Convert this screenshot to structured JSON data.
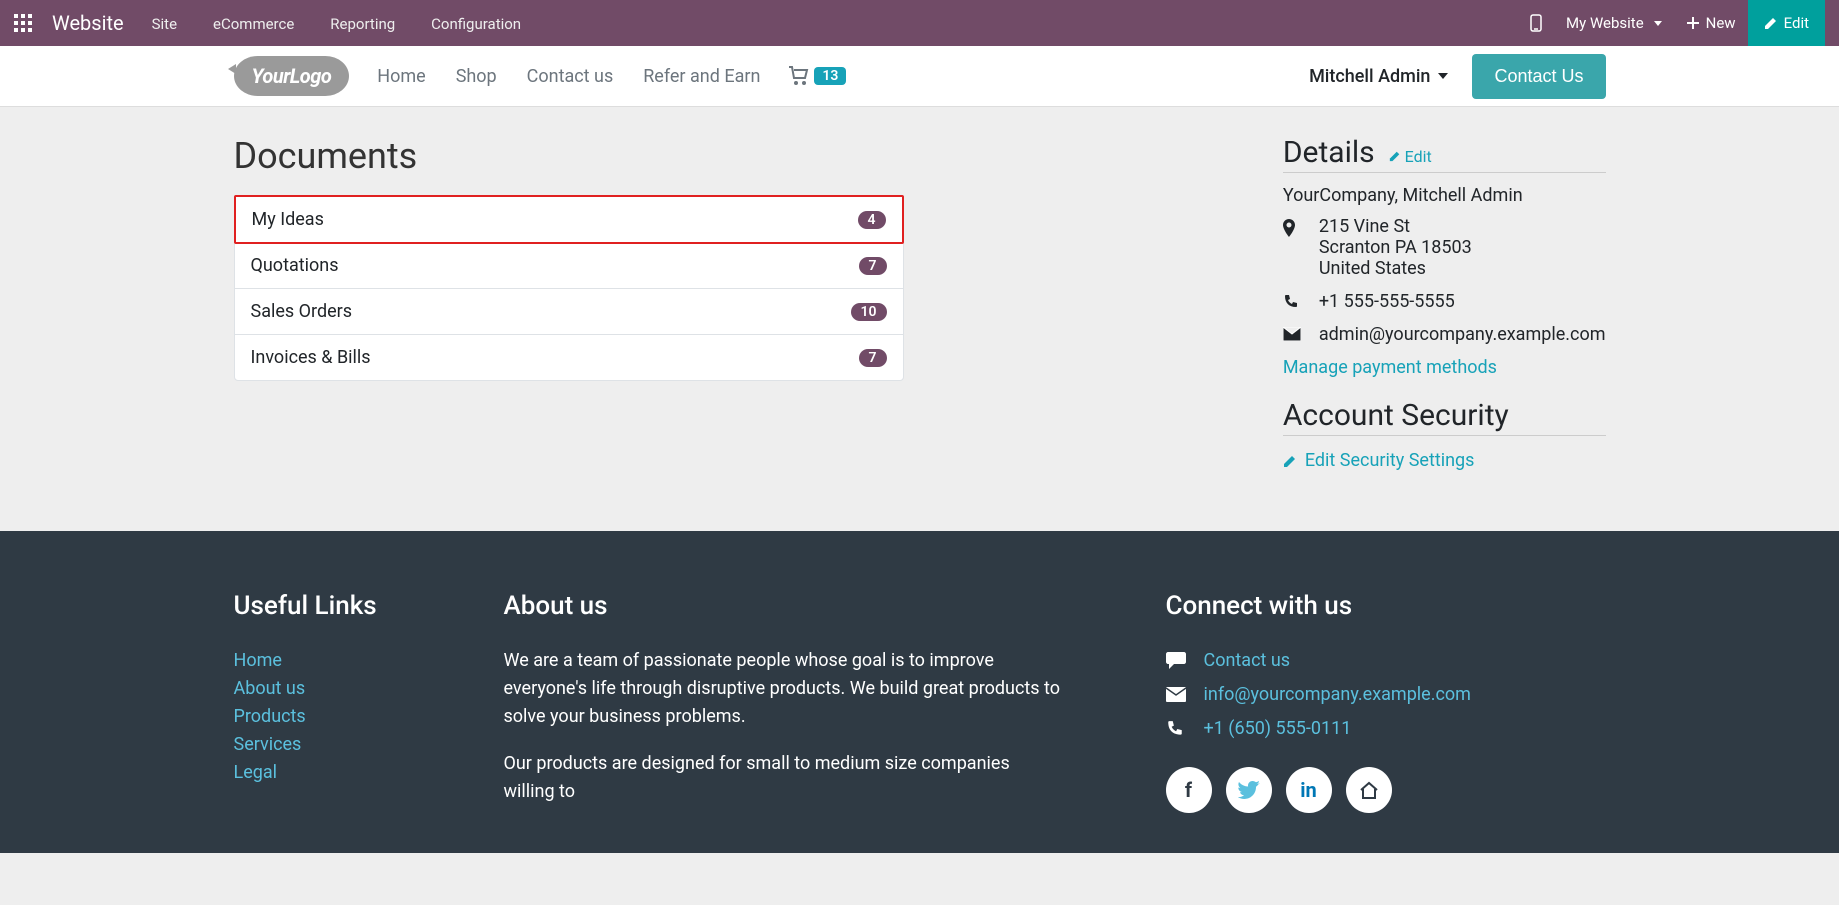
{
  "topbar": {
    "brand": "Website",
    "menu": [
      "Site",
      "eCommerce",
      "Reporting",
      "Configuration"
    ],
    "website_selector": "My Website",
    "new_label": "New",
    "edit_label": "Edit"
  },
  "siteheader": {
    "logo_text": "YourLogo",
    "nav": [
      "Home",
      "Shop",
      "Contact us",
      "Refer and Earn"
    ],
    "cart_count": "13",
    "user": "Mitchell Admin",
    "contact_btn": "Contact Us"
  },
  "main": {
    "title": "Documents",
    "items": [
      {
        "label": "My Ideas",
        "count": "4",
        "highlight": true
      },
      {
        "label": "Quotations",
        "count": "7",
        "highlight": false
      },
      {
        "label": "Sales Orders",
        "count": "10",
        "highlight": false
      },
      {
        "label": "Invoices & Bills",
        "count": "7",
        "highlight": false
      }
    ]
  },
  "details": {
    "heading": "Details",
    "edit_label": "Edit",
    "company": "YourCompany, Mitchell Admin",
    "address_line1": "215 Vine St",
    "address_line2": "Scranton PA 18503",
    "address_line3": "United States",
    "phone": "+1 555-555-5555",
    "email": "admin@yourcompany.example.com",
    "manage_payment": "Manage payment methods",
    "security_heading": "Account Security",
    "security_link": "Edit Security Settings"
  },
  "footer": {
    "useful_heading": "Useful Links",
    "useful_links": [
      "Home",
      "About us",
      "Products",
      "Services",
      "Legal"
    ],
    "about_heading": "About us",
    "about_p1": "We are a team of passionate people whose goal is to improve everyone's life through disruptive products. We build great products to solve your business problems.",
    "about_p2": "Our products are designed for small to medium size companies willing to",
    "connect_heading": "Connect with us",
    "connect_contact": "Contact us",
    "connect_email": "info@yourcompany.example.com",
    "connect_phone": "+1 (650) 555-0111"
  }
}
